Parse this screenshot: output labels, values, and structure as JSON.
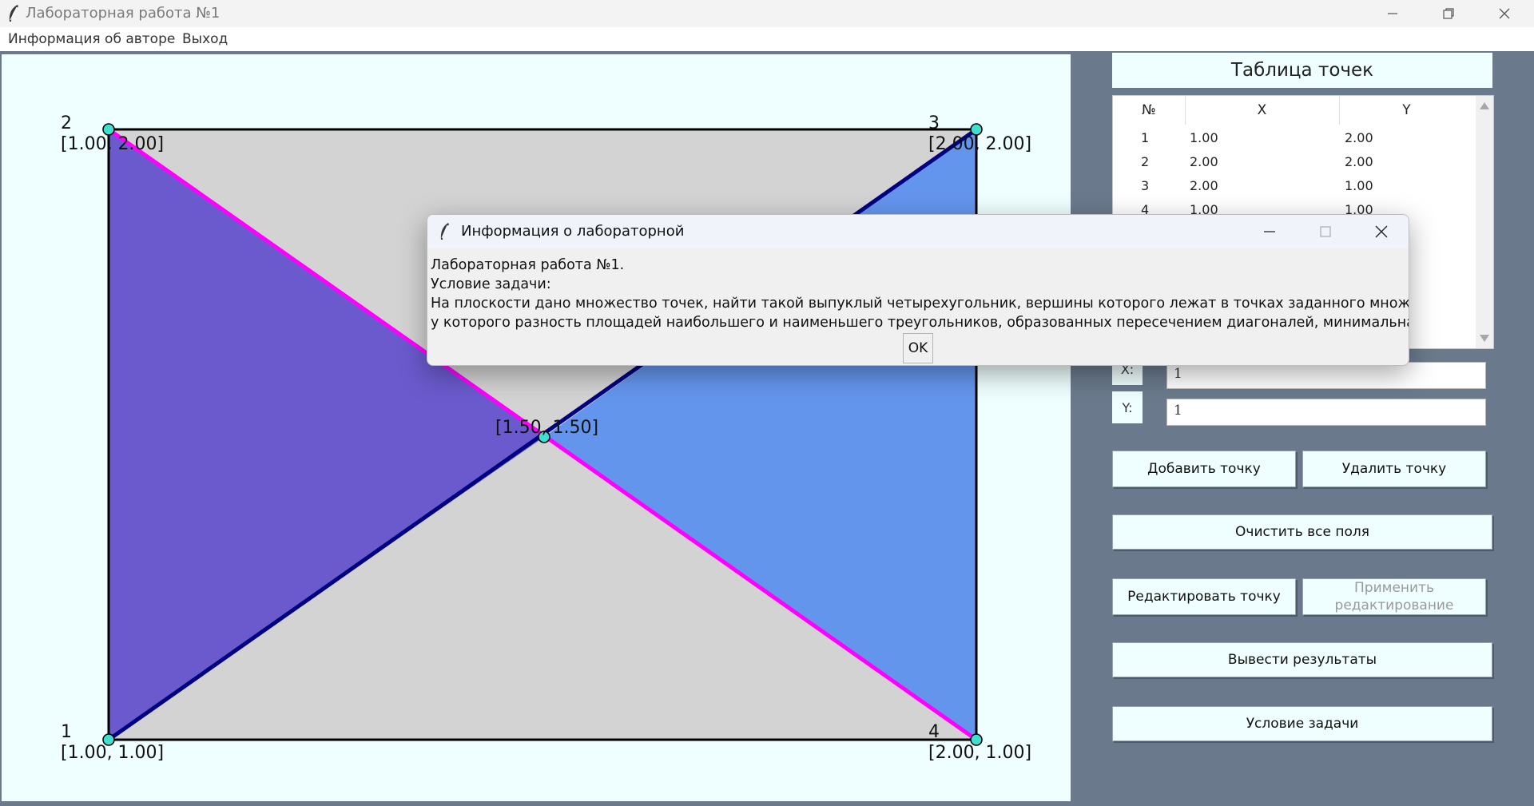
{
  "window": {
    "title": "Лабораторная работа №1",
    "controls": [
      "minimize-icon",
      "restore-icon",
      "close-icon"
    ]
  },
  "menu": {
    "items": [
      {
        "label": "Информация об авторе"
      },
      {
        "label": "Выход"
      }
    ]
  },
  "canvas": {
    "points": [
      {
        "number": "1",
        "coords": "[1.00, 1.00]"
      },
      {
        "number": "2",
        "coords": "[1.00, 2.00]"
      },
      {
        "number": "3",
        "coords": "[2.00, 2.00]"
      },
      {
        "number": "4",
        "coords": "[2.00, 1.00]"
      }
    ],
    "intersection_label": "[1.50, 1.50]",
    "colors": {
      "background": "#effefe",
      "rectangle_fill": "#d3d3d3",
      "triangle_left": "#6a5acd",
      "triangle_right": "#6495ed",
      "diagonal_1": "#ff00ff",
      "diagonal_2": "#000080",
      "point": "#40e0d0"
    }
  },
  "table": {
    "title": "Таблица точек",
    "headers": [
      "№",
      "X",
      "Y"
    ],
    "rows": [
      {
        "n": "1",
        "x": "1.00",
        "y": "2.00"
      },
      {
        "n": "2",
        "x": "2.00",
        "y": "2.00"
      },
      {
        "n": "3",
        "x": "2.00",
        "y": "1.00"
      },
      {
        "n": "4",
        "x": "1.00",
        "y": "1.00"
      }
    ]
  },
  "inputs": {
    "x_label": "X:",
    "x_value": "1",
    "y_label": "Y:",
    "y_value": "1"
  },
  "buttons": {
    "add": "Добавить точку",
    "delete": "Удалить точку",
    "clear": "Очистить все поля",
    "edit": "Редактировать точку",
    "apply": "Применить редактирование",
    "results": "Вывести результаты",
    "task": "Условие задачи"
  },
  "dialog": {
    "title": "Информация о лабораторной",
    "line1": "Лабораторная работа №1.",
    "line2": "Условие задачи:",
    "line3": "На плоскости дано множество точек, найти такой выпуклый четырехугольник, вершины которого лежат в точках заданного множества,",
    "line4": "у которого разность площадей наибольшего и наименьшего треугольников, образованных пересечением диагоналей, минимальна.",
    "ok": "OK"
  }
}
